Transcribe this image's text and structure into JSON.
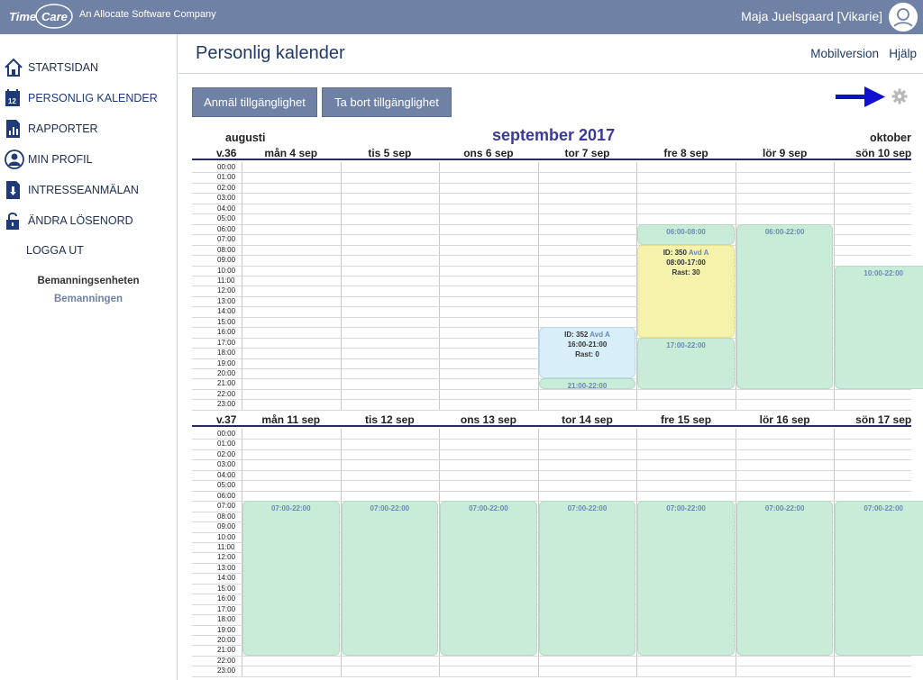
{
  "header": {
    "company": "An Allocate Software Company",
    "user_name": "Maja Juelsgaard [Vikarie]",
    "logo_time": "Time",
    "logo_care": "Care"
  },
  "sidebar": {
    "items": [
      {
        "label": "STARTSIDAN",
        "icon": "home-icon"
      },
      {
        "label": "PERSONLIG KALENDER",
        "icon": "calendar-icon"
      },
      {
        "label": "RAPPORTER",
        "icon": "reports-icon"
      },
      {
        "label": "MIN PROFIL",
        "icon": "profile-icon"
      },
      {
        "label": "INTRESSEANMÄLAN",
        "icon": "interest-icon"
      },
      {
        "label": "ÄNDRA LÖSENORD",
        "icon": "lock-icon"
      }
    ],
    "logout": "LOGGA UT",
    "unit": "Bemanningsenheten",
    "unit_sub": "Bemanningen"
  },
  "page": {
    "title": "Personlig kalender",
    "mobile_link": "Mobilversion",
    "help_link": "Hjälp",
    "btn_register": "Anmäl tillgänglighet",
    "btn_remove": "Ta bort tillgänglighet"
  },
  "calendar": {
    "month_prev": "augusti",
    "month_current": "september 2017",
    "month_next": "oktober",
    "hours": [
      "00:00",
      "01:00",
      "02:00",
      "03:00",
      "04:00",
      "05:00",
      "06:00",
      "07:00",
      "08:00",
      "09:00",
      "10:00",
      "11:00",
      "12:00",
      "13:00",
      "14:00",
      "15:00",
      "16:00",
      "17:00",
      "18:00",
      "19:00",
      "20:00",
      "21:00",
      "22:00",
      "23:00"
    ],
    "weeks": [
      {
        "label": "v.36",
        "days": [
          "mån 4 sep",
          "tis 5 sep",
          "ons 6 sep",
          "tor 7 sep",
          "fre 8 sep",
          "lör 9 sep",
          "sön 10 sep"
        ],
        "events": [
          {
            "day": 3,
            "start": 16,
            "end": 21,
            "kind": "blue",
            "lines": [
              {
                "a": "ID: 352 ",
                "b": "Avd A"
              },
              {
                "a": "16:00-21:00"
              },
              {
                "a": "Rast: 0"
              }
            ]
          },
          {
            "day": 3,
            "start": 21,
            "end": 22,
            "kind": "green",
            "lines": [
              {
                "a": "21:00-22:00"
              }
            ]
          },
          {
            "day": 4,
            "start": 6,
            "end": 8,
            "kind": "green",
            "lines": [
              {
                "a": "06:00-08:00"
              }
            ]
          },
          {
            "day": 4,
            "start": 8,
            "end": 17,
            "kind": "yellow",
            "lines": [
              {
                "a": "ID: 350 ",
                "b": "Avd A"
              },
              {
                "a": "08:00-17:00"
              },
              {
                "a": "Rast: 30"
              }
            ]
          },
          {
            "day": 4,
            "start": 17,
            "end": 22,
            "kind": "green",
            "lines": [
              {
                "a": "17:00-22:00"
              }
            ]
          },
          {
            "day": 5,
            "start": 6,
            "end": 22,
            "kind": "green",
            "lines": [
              {
                "a": "06:00-22:00"
              }
            ]
          },
          {
            "day": 6,
            "start": 10,
            "end": 22,
            "kind": "green",
            "lines": [
              {
                "a": "10:00-22:00"
              }
            ]
          }
        ]
      },
      {
        "label": "v.37",
        "days": [
          "mån 11 sep",
          "tis 12 sep",
          "ons 13 sep",
          "tor 14 sep",
          "fre 15 sep",
          "lör 16 sep",
          "sön 17 sep"
        ],
        "events": [
          {
            "day": 0,
            "start": 7,
            "end": 22,
            "kind": "green",
            "lines": [
              {
                "a": "07:00-22:00"
              }
            ]
          },
          {
            "day": 1,
            "start": 7,
            "end": 22,
            "kind": "green",
            "lines": [
              {
                "a": "07:00-22:00"
              }
            ]
          },
          {
            "day": 2,
            "start": 7,
            "end": 22,
            "kind": "green",
            "lines": [
              {
                "a": "07:00-22:00"
              }
            ]
          },
          {
            "day": 3,
            "start": 7,
            "end": 22,
            "kind": "green",
            "lines": [
              {
                "a": "07:00-22:00"
              }
            ]
          },
          {
            "day": 4,
            "start": 7,
            "end": 22,
            "kind": "green",
            "lines": [
              {
                "a": "07:00-22:00"
              }
            ]
          },
          {
            "day": 5,
            "start": 7,
            "end": 22,
            "kind": "green",
            "lines": [
              {
                "a": "07:00-22:00"
              }
            ]
          },
          {
            "day": 6,
            "start": 7,
            "end": 22,
            "kind": "green",
            "lines": [
              {
                "a": "07:00-22:00"
              }
            ]
          }
        ]
      }
    ]
  },
  "colors": {
    "topbar": "#6f82a6",
    "accent": "#1f3a6b",
    "event_green": "#c9ecd9",
    "event_yellow": "#f5f2ac",
    "event_blue": "#d8eef8",
    "arrow": "#1010d0"
  },
  "icons": {
    "settings": "gear-icon",
    "annotation": "arrow-icon",
    "user": "avatar-icon"
  }
}
